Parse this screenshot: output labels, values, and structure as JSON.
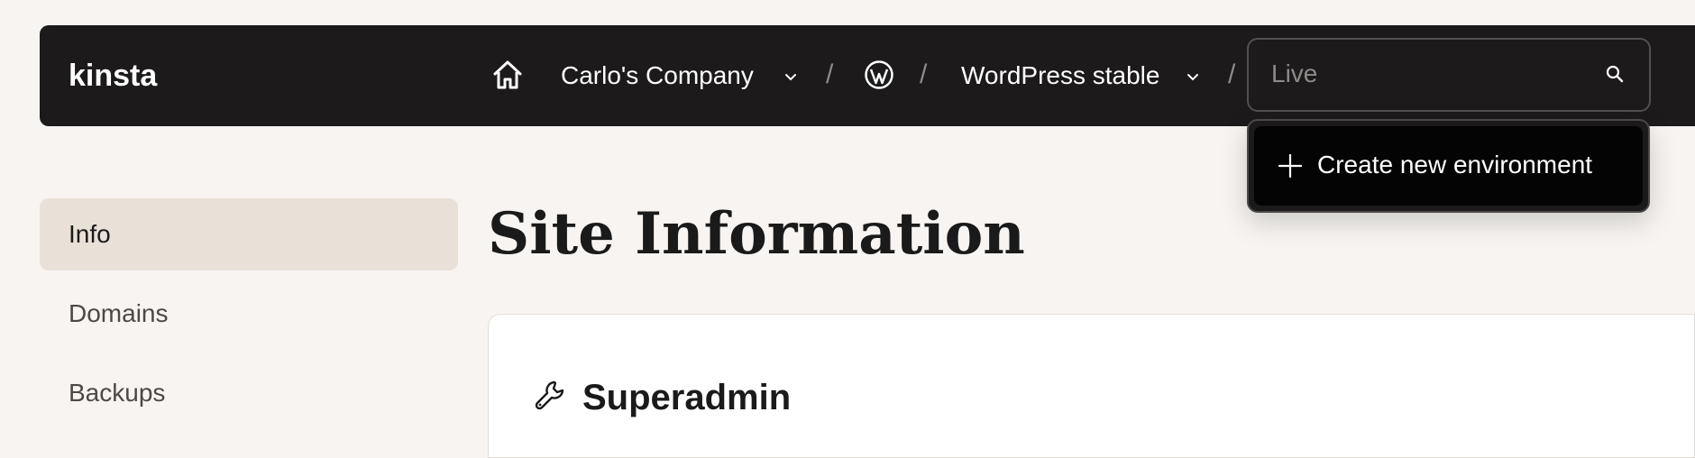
{
  "header": {
    "logo_text": "kinsta",
    "company": "Carlo's Company",
    "separator": "/",
    "site": "WordPress stable",
    "environment_placeholder": "Live"
  },
  "env_dropdown": {
    "create_label": "Create new environment"
  },
  "sidebar": {
    "items": [
      {
        "label": "Info",
        "active": true
      },
      {
        "label": "Domains",
        "active": false
      },
      {
        "label": "Backups",
        "active": false
      }
    ]
  },
  "main": {
    "title": "Site Information",
    "card_title": "Superadmin"
  },
  "colors": {
    "topbar": "#1c1a1b",
    "page_bg": "#f7f4f1",
    "active_sidebar": "#e9e0d8"
  },
  "icons": [
    "home-icon",
    "chevron-down-icon",
    "wordpress-icon",
    "search-icon",
    "plus-icon",
    "wrench-icon"
  ]
}
